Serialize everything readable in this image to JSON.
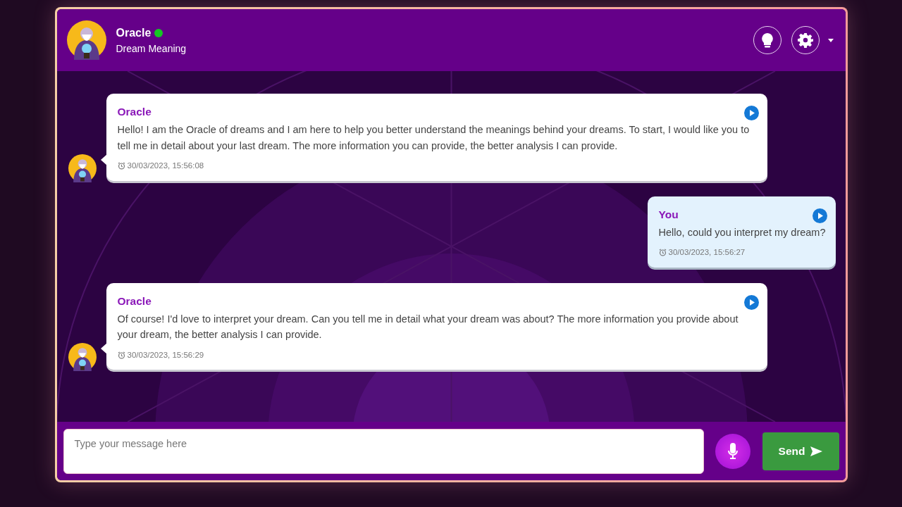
{
  "header": {
    "name": "Oracle",
    "online": true,
    "subtitle": "Dream Meaning"
  },
  "messages": [
    {
      "kind": "bot",
      "sender": "Oracle",
      "text": "Hello! I am the Oracle of dreams and I am here to help you better understand the meanings behind your dreams. To start, I would like you to tell me in detail about your last dream. The more information you can provide, the better analysis I can provide.",
      "time": "30/03/2023, 15:56:08"
    },
    {
      "kind": "user",
      "sender": "You",
      "text": "Hello, could you interpret my dream?",
      "time": "30/03/2023, 15:56:27"
    },
    {
      "kind": "bot",
      "sender": "Oracle",
      "text": "Of course! I'd love to interpret your dream. Can you tell me in detail what your dream was about? The more information you provide about your dream, the better analysis I can provide.",
      "time": "30/03/2023, 15:56:29"
    }
  ],
  "composer": {
    "placeholder": "Type your message here",
    "send_label": "Send"
  }
}
